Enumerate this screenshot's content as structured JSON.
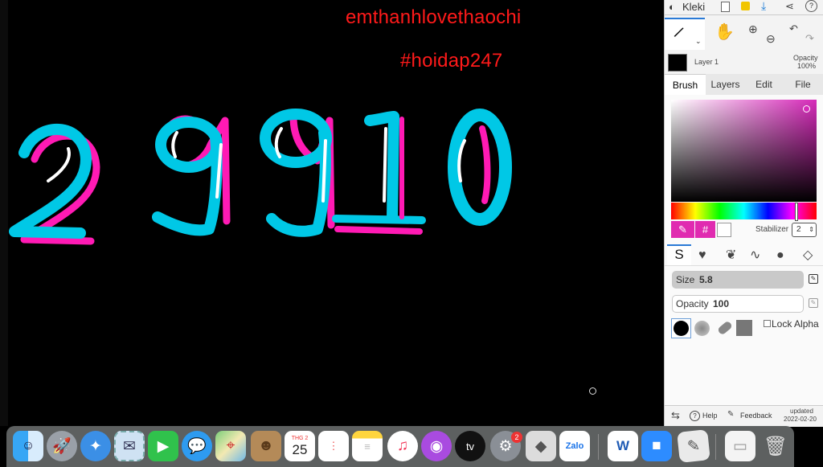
{
  "watermark": {
    "line1": "emthanhlovethaochi",
    "line2": "#hoidap247"
  },
  "canvas": {
    "digits": [
      "2",
      "9",
      "9",
      "1",
      "0"
    ]
  },
  "app": {
    "name": "Kleki",
    "layer": {
      "name": "Layer 1",
      "opacity_label": "Opacity",
      "opacity_value": "100%"
    },
    "tabs": [
      "Brush",
      "Layers",
      "Edit",
      "File"
    ],
    "active_tab": "Brush",
    "stabilizer": {
      "label": "Stabilizer",
      "value": "2"
    },
    "size": {
      "label": "Size",
      "value": "5.8"
    },
    "opacity": {
      "label": "Opacity",
      "value": "100"
    },
    "lock_alpha": "Lock Alpha",
    "footer": {
      "help": "Help",
      "feedback": "Feedback",
      "updated_line1": "updated",
      "updated_line2": "2022-02-20"
    },
    "hex_symbol": "#"
  },
  "dock": {
    "calendar_month": "THG 2",
    "calendar_day": "25",
    "settings_badge": "2",
    "zalo_label": "Zalo",
    "appletv_label": "tv",
    "word_label": "W"
  },
  "colors": {
    "cyan": "#00c8e6",
    "magenta": "#ff1ab4",
    "watermark_red": "#ff1a1a",
    "panel_bg": "#f3f3f3"
  }
}
